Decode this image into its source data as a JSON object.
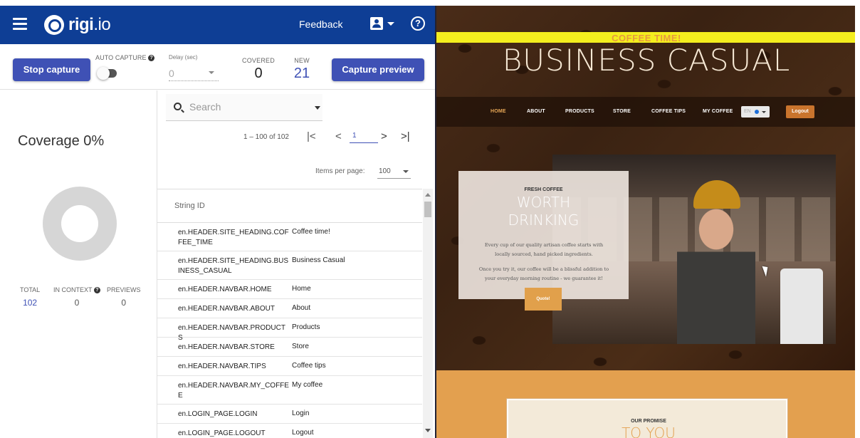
{
  "app": {
    "logo": "rigi",
    "logo_tld": ".io",
    "feedback": "Feedback",
    "help_glyph": "?"
  },
  "toolbar": {
    "stop_capture": "Stop capture",
    "auto_capture": "AUTO CAPTURE",
    "delay_label": "Delay (sec)",
    "delay_value": "0",
    "covered_label": "COVERED",
    "covered_value": "0",
    "new_label": "NEW",
    "new_value": "21",
    "capture_preview": "Capture preview"
  },
  "coverage": {
    "title": "Coverage 0%",
    "total_label": "TOTAL",
    "total_value": "102",
    "in_context_label": "IN CONTEXT",
    "in_context_value": "0",
    "previews_label": "PREVIEWS",
    "previews_value": "0",
    "percent": 0
  },
  "strings": {
    "search_placeholder": "Search",
    "range_label": "1 – 100 of 102",
    "page": "1",
    "items_per_page_label": "Items per page:",
    "items_per_page": "100",
    "column_header": "String ID",
    "rows": [
      {
        "id": "en.HEADER.SITE_HEADING.COFFEE_TIME",
        "value": "Coffee time!"
      },
      {
        "id": "en.HEADER.SITE_HEADING.BUSINESS_CASUAL",
        "value": "Business Casual"
      },
      {
        "id": "en.HEADER.NAVBAR.HOME",
        "value": "Home"
      },
      {
        "id": "en.HEADER.NAVBAR.ABOUT",
        "value": "About"
      },
      {
        "id": "en.HEADER.NAVBAR.PRODUCTS",
        "value": "Products"
      },
      {
        "id": "en.HEADER.NAVBAR.STORE",
        "value": "Store"
      },
      {
        "id": "en.HEADER.NAVBAR.TIPS",
        "value": "Coffee tips"
      },
      {
        "id": "en.HEADER.NAVBAR.MY_COFFEE",
        "value": "My coffee"
      },
      {
        "id": "en.LOGIN_PAGE.LOGIN",
        "value": "Login"
      },
      {
        "id": "en.LOGIN_PAGE.LOGOUT",
        "value": "Logout"
      }
    ]
  },
  "preview": {
    "coffee_time": "COFFEE TIME!",
    "site_title": "BUSINESS CASUAL",
    "nav": {
      "home": "HOME",
      "about": "ABOUT",
      "products": "PRODUCTS",
      "store": "STORE",
      "tips": "COFFEE TIPS",
      "my_coffee": "MY COFFEE",
      "lang": "EN",
      "logout": "Logout"
    },
    "promo_eyebrow": "FRESH COFFEE",
    "promo_title_1": "WORTH",
    "promo_title_2": "DRINKING",
    "promo_text_1": "Every cup of our quality artisan coffee starts with locally sourced, hand picked ingredients.",
    "promo_text_2": "Once you try it, our coffee will be a blissful addition to your everyday morning routine - we guarantee it!",
    "quote_button": "Quote!",
    "promise_eyebrow": "OUR PROMISE",
    "promise_title": "TO YOU"
  },
  "colors": {
    "brand_blue": "#0e3e95",
    "button_indigo": "#3f51b5",
    "coffee_yellow": "#f4ee1e",
    "accent_orange": "#e3a04f"
  }
}
